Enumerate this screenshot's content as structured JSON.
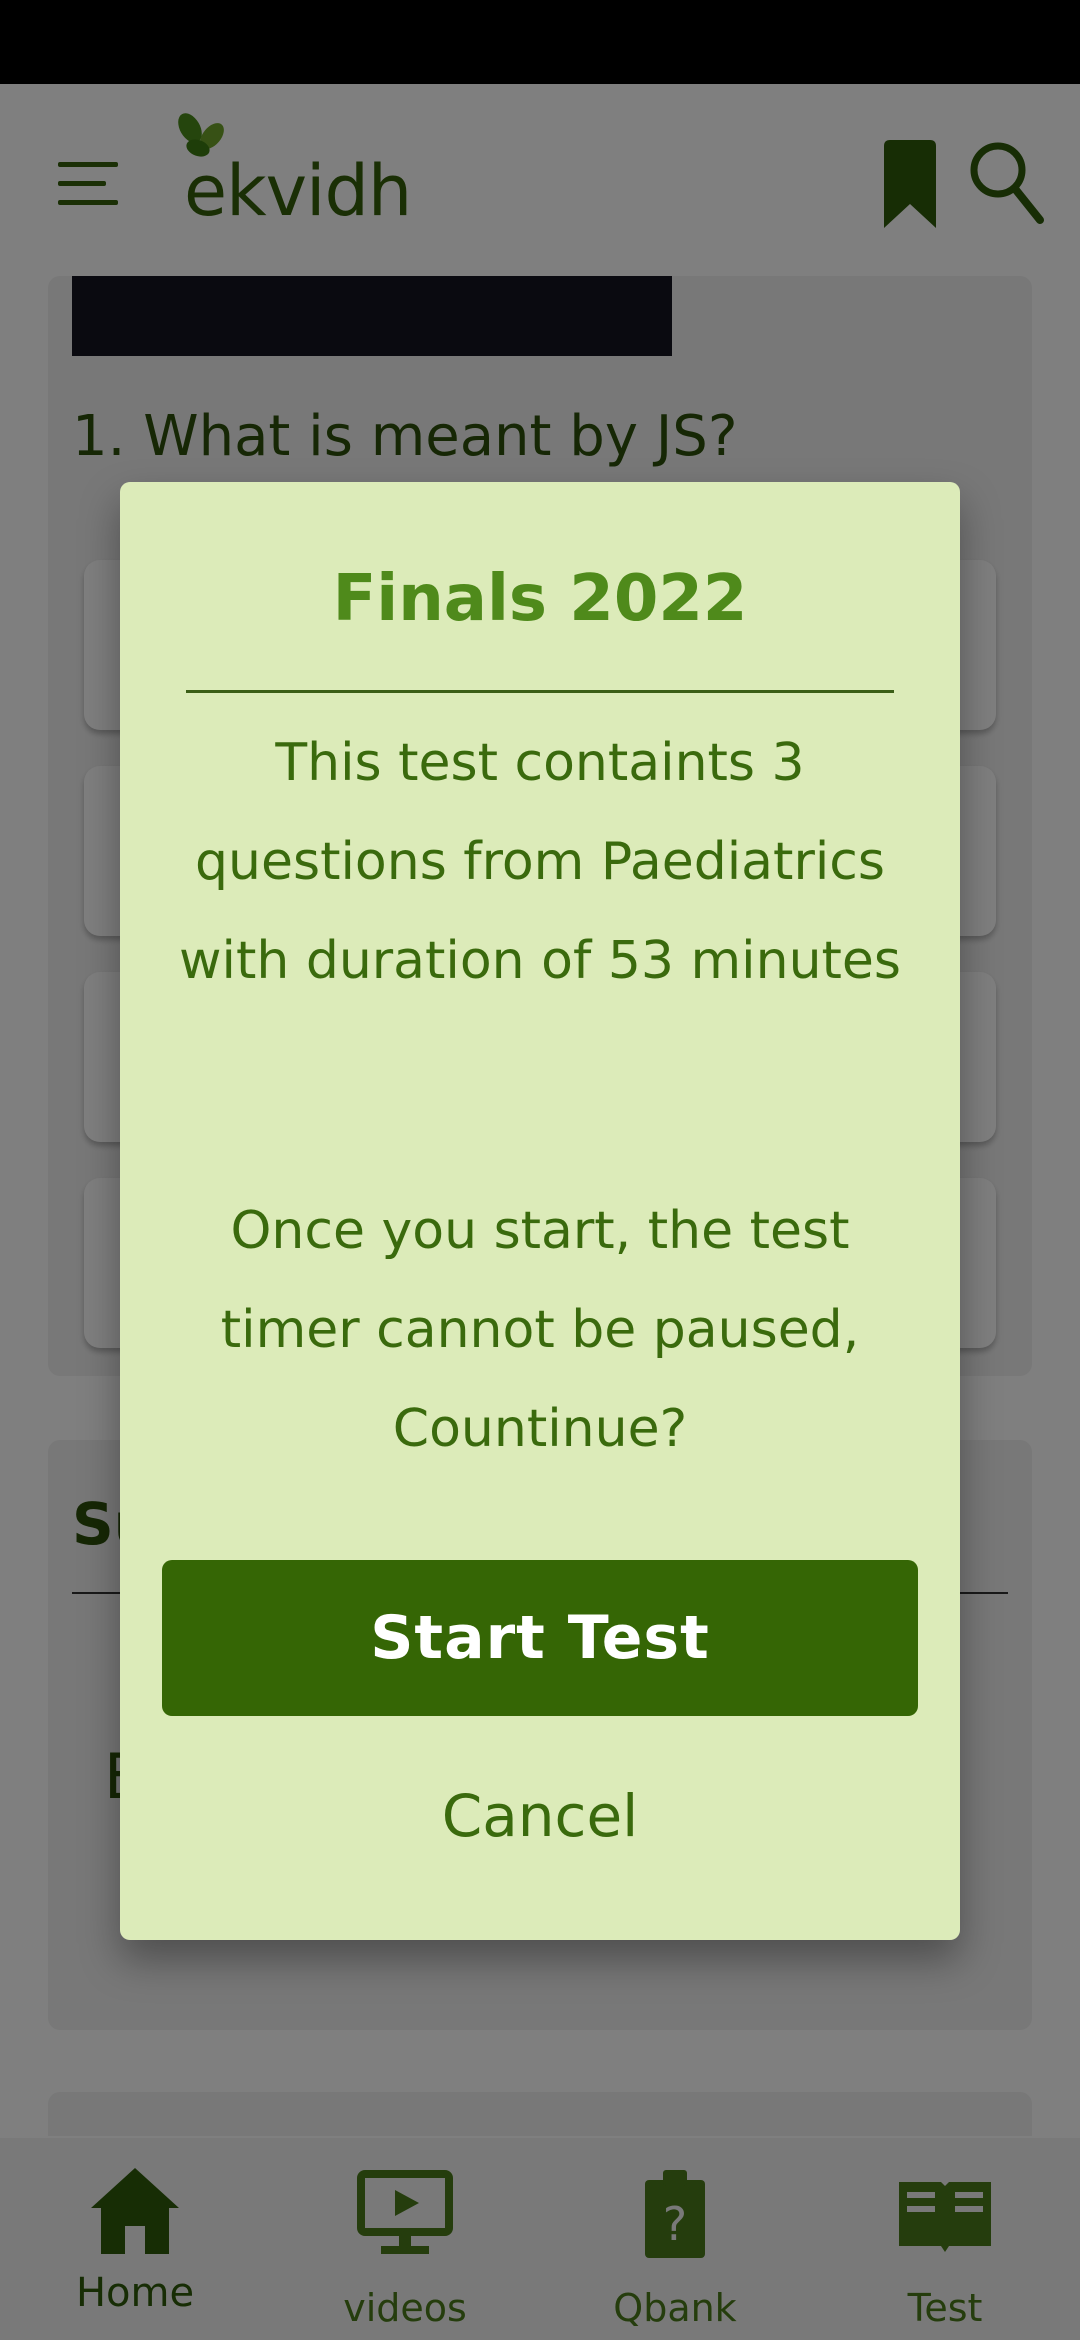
{
  "app": {
    "logo_text": "ekvidh"
  },
  "question": {
    "text": "1. What is meant by JS?"
  },
  "summary": {
    "title_partial": "Su",
    "letter_partial": "E"
  },
  "dialog": {
    "title": "Finals 2022",
    "message": "This test containts 3 questions from Paediatrics with duration of 53 minutes",
    "warning": "Once you start, the test timer cannot be paused, Countinue?",
    "start_label": "Start Test",
    "cancel_label": "Cancel"
  },
  "bottom_nav": {
    "items": [
      {
        "label": "Home",
        "icon": "home-icon"
      },
      {
        "label": "videos",
        "icon": "video-icon"
      },
      {
        "label": "Qbank",
        "icon": "qbank-icon"
      },
      {
        "label": "Test",
        "icon": "book-icon"
      }
    ]
  },
  "colors": {
    "brand_green": "#356605",
    "dialog_bg": "#dcebb9",
    "title_green": "#4f8a1b"
  }
}
